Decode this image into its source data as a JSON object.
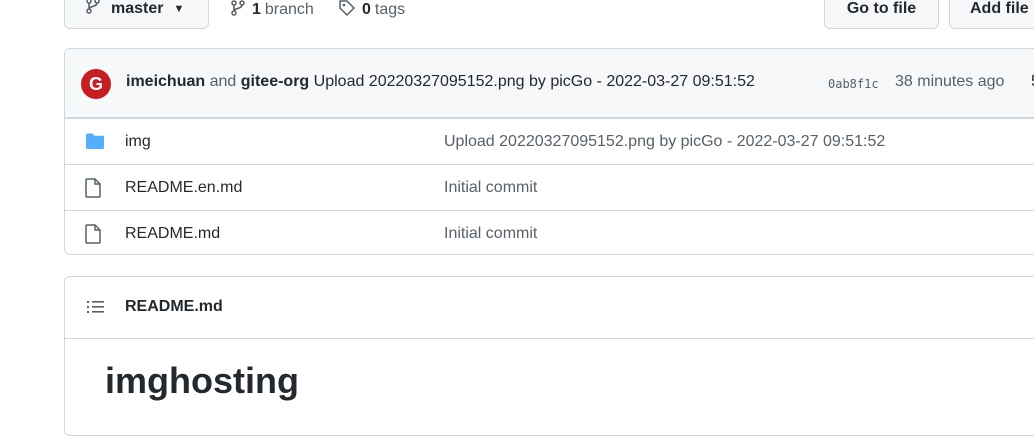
{
  "toolbar": {
    "branch_name": "master",
    "branch_count": "1",
    "branch_label": "branch",
    "tag_count": "0",
    "tag_label": "tags",
    "go_to_file": "Go to file",
    "add_file": "Add file"
  },
  "commit": {
    "avatar_letter": "G",
    "author": "imeichuan",
    "joiner": "and",
    "coauthor": "gitee-org",
    "message": "Upload 20220327095152.png by picGo - 2022-03-27 09:51:52",
    "sha": "0ab8f1c",
    "time": "38 minutes ago",
    "history_glyph": "5"
  },
  "files": [
    {
      "name": "img",
      "type": "folder",
      "message": "Upload 20220327095152.png by picGo - 2022-03-27 09:51:52"
    },
    {
      "name": "README.en.md",
      "type": "file",
      "message": "Initial commit"
    },
    {
      "name": "README.md",
      "type": "file",
      "message": "Initial commit"
    }
  ],
  "readme": {
    "filename": "README.md",
    "heading": "imghosting"
  },
  "icons": {
    "branch": "git-branch-icon",
    "tag": "tag-icon",
    "folder": "folder-icon",
    "file": "file-icon",
    "toc": "list-icon"
  },
  "colors": {
    "folder": "#54aeff",
    "avatar_bg": "#c71d23",
    "border": "#d0d7de",
    "muted": "#57606a"
  }
}
